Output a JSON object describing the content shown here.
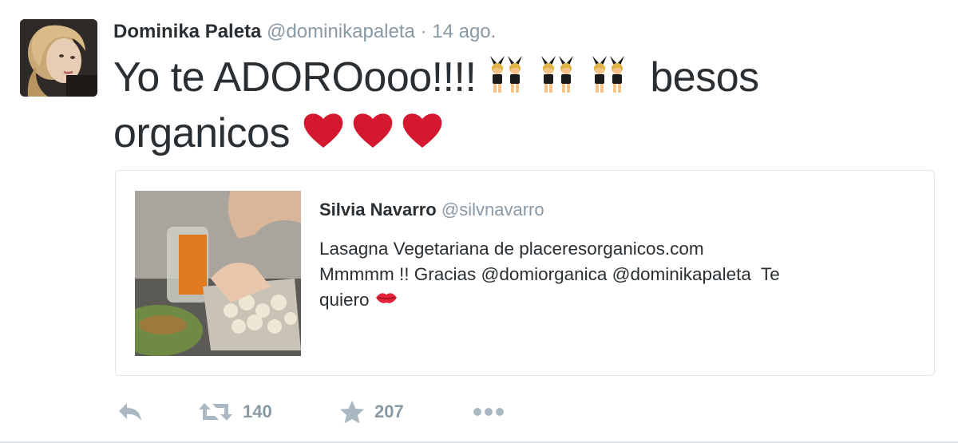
{
  "tweet": {
    "author_name": "Dominika Paleta",
    "author_handle": "@dominikapaleta",
    "separator": "·",
    "time": "14 ago.",
    "text_part1": "Yo te ADOROooo!!!!",
    "text_emoji_1": "women-with-bunny-ears-emoji x3",
    "text_part2": "besos organicos",
    "text_emoji_2": "red-heart-emoji x3"
  },
  "quoted_tweet": {
    "author_name": "Silvia Navarro",
    "author_handle": "@silvnavarro",
    "text_line1": "Lasagna Vegetariana de placeresorganicos.com",
    "text_line2": "Mmmmm !! Gracias @domiorganica @dominikapaleta  Te",
    "text_line3": "quiero",
    "text_emoji": "kiss-mark-emoji"
  },
  "actions": {
    "reply_icon": "reply-icon",
    "retweet_icon": "retweet-icon",
    "retweet_count": "140",
    "favorite_icon": "star-icon",
    "favorite_count": "207",
    "more_icon": "more-dots-icon"
  },
  "colors": {
    "text": "#292f33",
    "secondary": "#8899a6",
    "border": "#e1e8ed",
    "heart": "#d3182f"
  }
}
